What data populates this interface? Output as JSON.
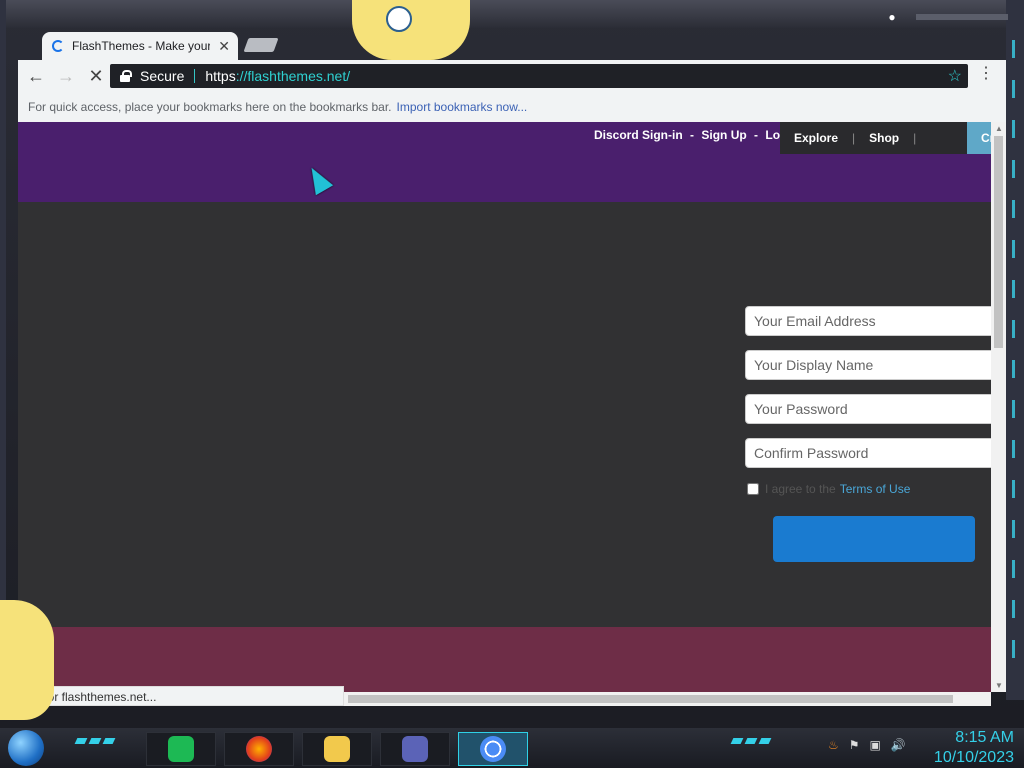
{
  "browser": {
    "tab_title": "FlashThemes - Make your",
    "tab_close": "✕",
    "back": "←",
    "forward": "→",
    "stop": "✕",
    "secure_label": "Secure",
    "url_scheme": "https",
    "url_sep": "://",
    "url_host": "flashthemes.net/",
    "star_icon": "☆",
    "menu_icon": "⋮",
    "bookmarks_hint": "For quick access, place your bookmarks here on the bookmarks bar.",
    "import_bookmarks": "Import bookmarks now...",
    "status_text": "ing for flashthemes.net..."
  },
  "site": {
    "auth_links": [
      "Discord Sign-in",
      "Sign Up",
      "Login"
    ],
    "auth_sep": "-",
    "nav": [
      "Explore",
      "Shop"
    ],
    "nav_sep": "|",
    "create_label": "Cr",
    "form": {
      "email_placeholder": "Your Email Address",
      "display_name_placeholder": "Your Display Name",
      "password_placeholder": "Your Password",
      "confirm_placeholder": "Confirm Password",
      "agree_text": "I agree to the",
      "terms_link": "Terms of Use"
    },
    "colors": {
      "header": "#4a1f6d",
      "body": "#313133",
      "footer": "#6e2d47",
      "submit": "#1a7bd0"
    }
  },
  "taskbar": {
    "time": "8:15 AM",
    "date": "10/10/2023"
  }
}
